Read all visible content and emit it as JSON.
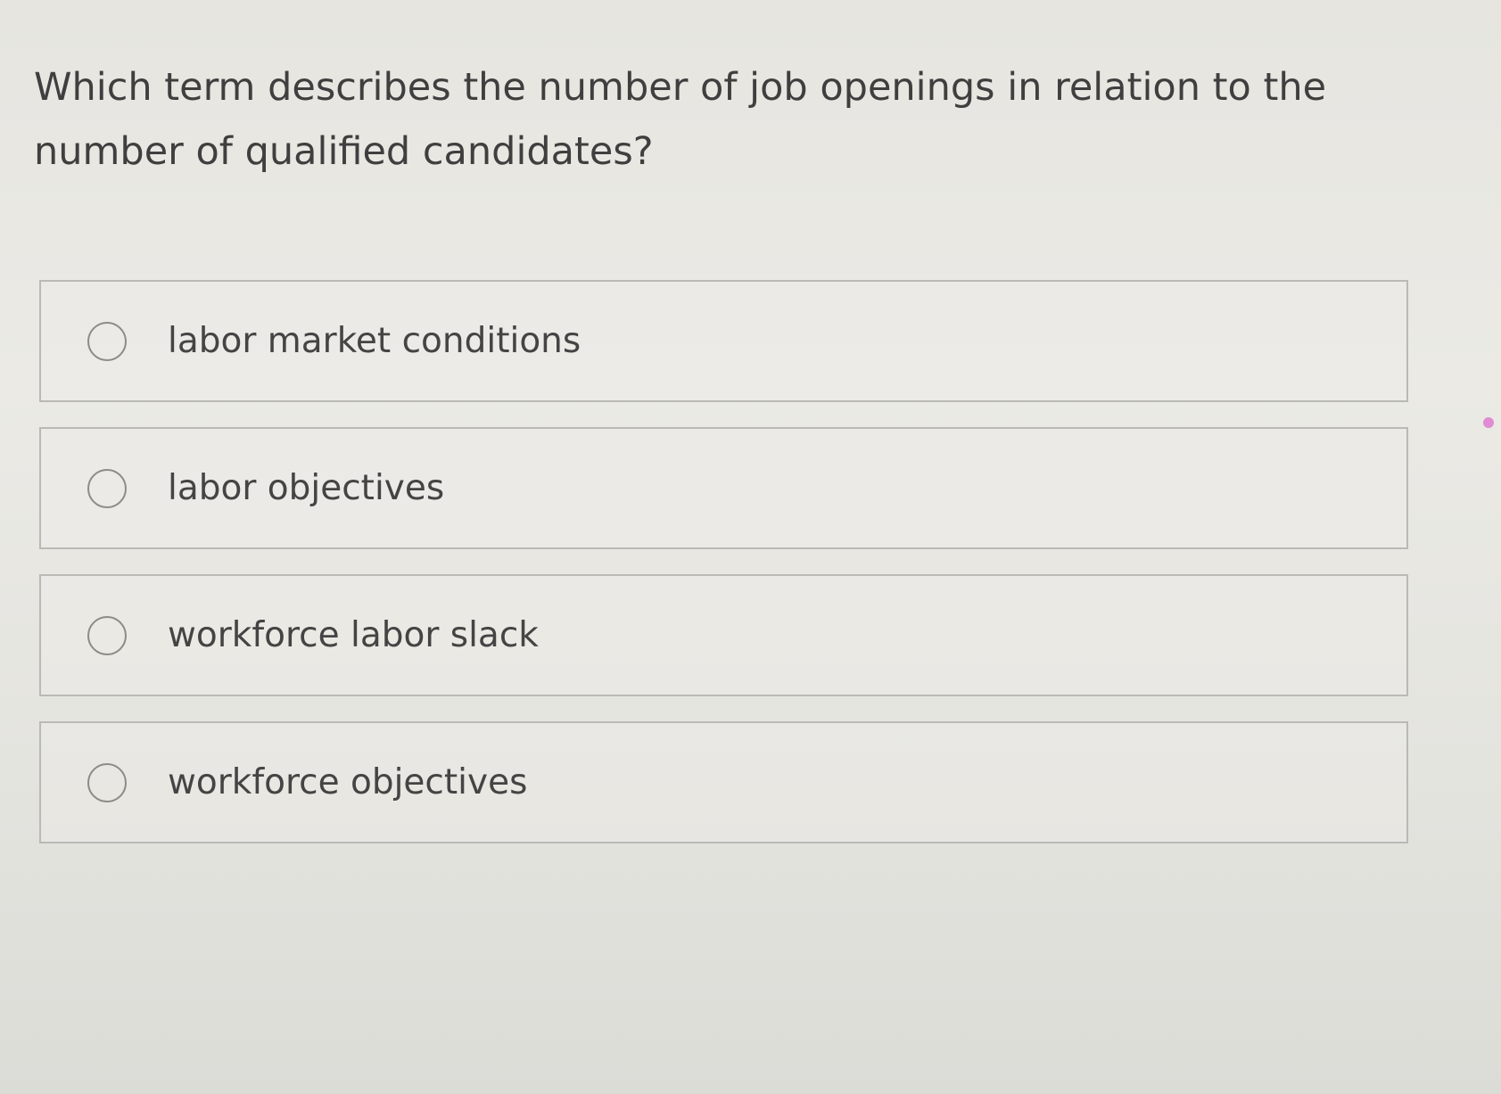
{
  "question": {
    "text": "Which term describes the number of job openings in relation to the number of qualified candidates?"
  },
  "options": [
    {
      "label": "labor market conditions",
      "selected": false
    },
    {
      "label": "labor objectives",
      "selected": false
    },
    {
      "label": "workforce labor slack",
      "selected": false
    },
    {
      "label": "workforce objectives",
      "selected": false
    }
  ]
}
